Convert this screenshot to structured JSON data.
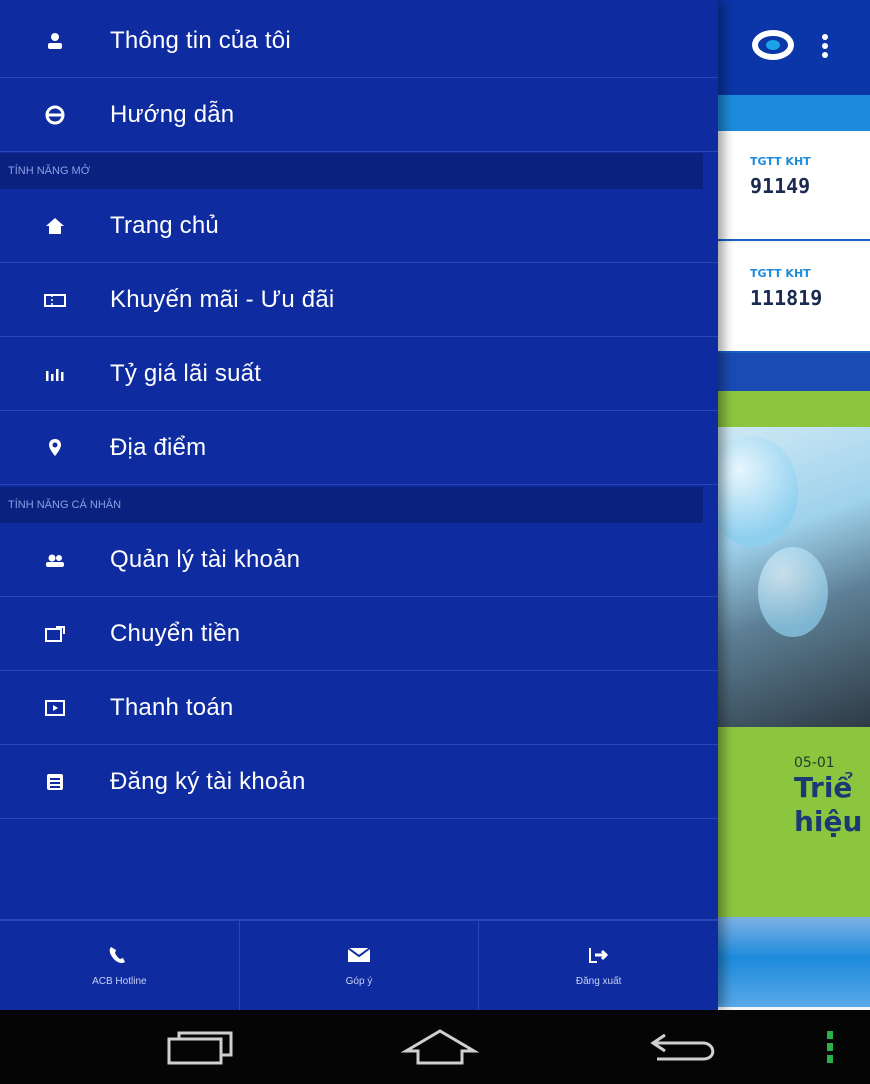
{
  "drawer": {
    "top_items": [
      {
        "label": "Thông tin của tôi",
        "icon": "user-icon"
      },
      {
        "label": "Hướng dẫn",
        "icon": "help-icon"
      }
    ],
    "sections": [
      {
        "title": "TÍNH NĂNG MỞ",
        "items": [
          {
            "label": "Trang chủ",
            "icon": "home-icon"
          },
          {
            "label": "Khuyến mãi - Ưu đãi",
            "icon": "ticket-icon"
          },
          {
            "label": "Tỷ giá lãi suất",
            "icon": "bar-chart-icon"
          },
          {
            "label": "Địa điểm",
            "icon": "location-pin-icon"
          }
        ]
      },
      {
        "title": "TÍNH NĂNG CÁ NHÂN",
        "items": [
          {
            "label": "Quản lý tài khoản",
            "icon": "account-manage-icon"
          },
          {
            "label": "Chuyển tiền",
            "icon": "transfer-icon"
          },
          {
            "label": "Thanh toán",
            "icon": "payment-icon"
          },
          {
            "label": "Đăng ký tài khoản",
            "icon": "register-icon"
          }
        ]
      }
    ],
    "bottom_tabs": [
      {
        "label": "ACB Hotline",
        "icon": "phone-icon"
      },
      {
        "label": "Góp ý",
        "icon": "mail-icon"
      },
      {
        "label": "Đăng xuất",
        "icon": "logout-icon"
      }
    ]
  },
  "main": {
    "cards": [
      {
        "label": "TGTT KHT",
        "number": "91149"
      },
      {
        "label": "TGTT KHT",
        "number": "111819"
      }
    ],
    "news": {
      "date": "05-01",
      "title_line1": "Triể",
      "title_line2": "hiệu"
    }
  },
  "colors": {
    "drawer_bg": "#0f2ba0",
    "accent_blue": "#1d8bdc",
    "accent_green": "#8cc63f"
  }
}
